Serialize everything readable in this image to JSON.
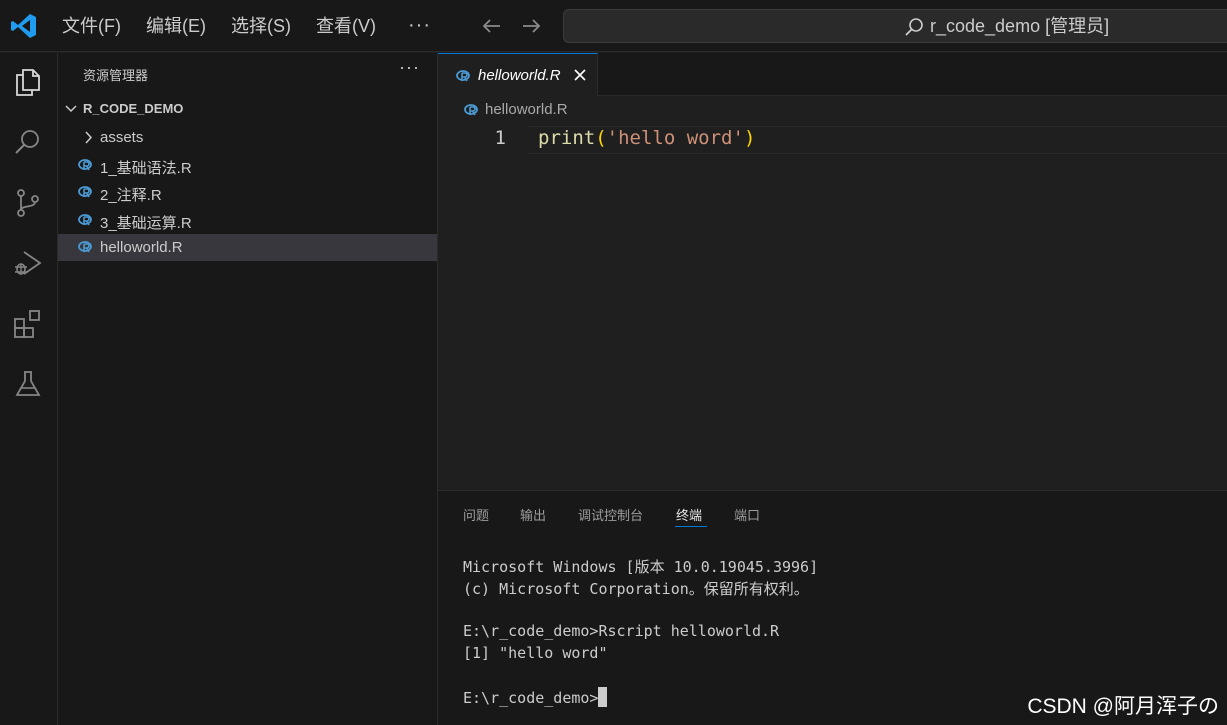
{
  "titlebar": {
    "menu": [
      {
        "label": "文件(F)"
      },
      {
        "label": "编辑(E)"
      },
      {
        "label": "选择(S)"
      },
      {
        "label": "查看(V)"
      }
    ],
    "more": "···",
    "search_text": "r_code_demo [管理员]"
  },
  "activitybar": {
    "icons": [
      "explorer-icon",
      "search-icon",
      "source-control-icon",
      "run-debug-icon",
      "extensions-icon",
      "testing-icon"
    ]
  },
  "sidebar": {
    "title": "资源管理器",
    "more": "···",
    "folder": "R_CODE_DEMO",
    "items": [
      {
        "label": "assets",
        "type": "folder"
      },
      {
        "label": "1_基础语法.R",
        "type": "file"
      },
      {
        "label": "2_注释.R",
        "type": "file"
      },
      {
        "label": "3_基础运算.R",
        "type": "file"
      },
      {
        "label": "helloworld.R",
        "type": "file",
        "selected": true
      }
    ]
  },
  "editor": {
    "tab_label": "helloworld.R",
    "breadcrumb": "helloworld.R",
    "line_number": "1",
    "code": {
      "fn": "print",
      "open": "(",
      "str": "'hello word'",
      "close": ")"
    }
  },
  "panel": {
    "tabs": [
      {
        "label": "问题"
      },
      {
        "label": "输出"
      },
      {
        "label": "调试控制台"
      },
      {
        "label": "终端",
        "active": true
      },
      {
        "label": "端口"
      }
    ],
    "terminal": [
      "Microsoft Windows [版本 10.0.19045.3996]",
      "(c) Microsoft Corporation。保留所有权利。",
      "E:\\r_code_demo>Rscript helloworld.R",
      "[1] \"hello word\"",
      "E:\\r_code_demo>"
    ]
  },
  "watermark": "CSDN @阿月浑子の",
  "colors": {
    "accent": "#0078d4",
    "r_icon": "#4b9ad4",
    "background": "#1f1f1f"
  }
}
